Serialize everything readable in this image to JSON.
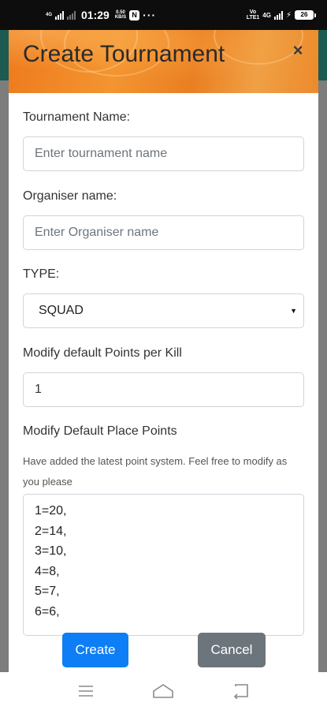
{
  "status_bar": {
    "time": "01:29",
    "speed_value": "0.50",
    "speed_unit": "KB/S",
    "notification_badge": "N",
    "more": "···",
    "network_left": "4G",
    "volte_top": "Vo",
    "volte_bottom": "LTE1",
    "network_right": "4G",
    "battery": "26"
  },
  "modal": {
    "title": "Create Tournament",
    "close_symbol": "×",
    "fields": {
      "tournament_name_label": "Tournament Name:",
      "tournament_name_placeholder": "Enter tournament name",
      "tournament_name_value": "",
      "organiser_label": "Organiser name:",
      "organiser_placeholder": "Enter Organiser name",
      "organiser_value": "",
      "type_label": "TYPE:",
      "type_selected": "SQUAD",
      "kill_points_label": "Modify default Points per Kill",
      "kill_points_value": "1",
      "place_points_label": "Modify Default Place Points",
      "place_points_help": "Have added the latest point system. Feel free to modify as you please",
      "place_points_lines": [
        "1=20,",
        "2=14,",
        "3=10,",
        "4=8,",
        "5=7,",
        "6=6,"
      ]
    },
    "buttons": {
      "create": "Create",
      "cancel": "Cancel"
    }
  },
  "nav_bar": {
    "icons": [
      "menu-icon",
      "home-icon",
      "back-icon"
    ]
  }
}
